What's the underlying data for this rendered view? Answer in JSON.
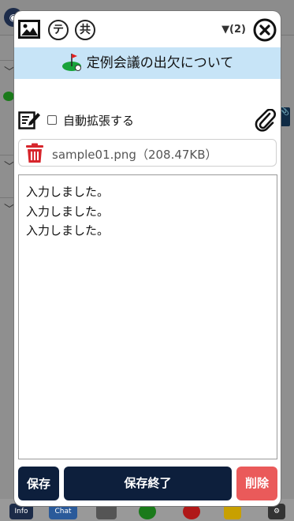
{
  "background": {
    "avatar_label": "◉",
    "rows": [
      "﹀",
      "﹀",
      "﹀"
    ],
    "right_tab": "📎",
    "footer": [
      "Info",
      "Chat",
      "",
      "",
      "",
      "",
      "⚙"
    ]
  },
  "toolbar": {
    "te_label": "テ",
    "kyo_label": "共",
    "count": "▼(2)"
  },
  "title": "定例会議の出欠について",
  "option": {
    "auto_expand_label": "自動拡張する",
    "auto_expand_checked": false
  },
  "attachment": {
    "name": "sample01.png（208.47KB）"
  },
  "body": {
    "lines": [
      "入力しました。",
      "入力しました。",
      "入力しました。"
    ]
  },
  "buttons": {
    "save": "保存",
    "save_close": "保存終了",
    "delete": "削除"
  },
  "colors": {
    "title_bar": "#c7e4f7",
    "primary_button": "#0d1f3c",
    "delete_button": "#ea5a5a",
    "trash": "#d7262c"
  }
}
